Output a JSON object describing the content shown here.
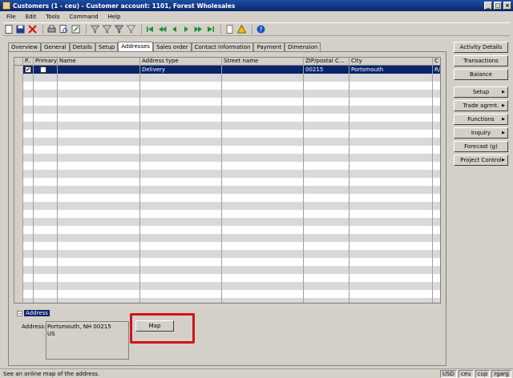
{
  "window": {
    "title": "Customers (1 - ceu) - Customer account: 1101, Forest Wholesales",
    "min_glyph": "_",
    "max_glyph": "□",
    "close_glyph": "×"
  },
  "menu": {
    "items": [
      "File",
      "Edit",
      "Tools",
      "Command",
      "Help"
    ]
  },
  "tabs": [
    "Overview",
    "General",
    "Details",
    "Setup",
    "Addresses",
    "Sales order",
    "Contact information",
    "Payment",
    "Dimension"
  ],
  "grid": {
    "columns": [
      "P..",
      "Primary",
      "Name",
      "Address type",
      "Street name",
      "ZIP/postal C...",
      "City",
      "C"
    ],
    "rows": [
      {
        "primary_marker": "✔",
        "primary": "",
        "name": "",
        "address_type": "Delivery",
        "street": "",
        "zip": "00215",
        "city": "Portsmouth",
        "c": "R/"
      }
    ]
  },
  "address_group": {
    "toggle": "−",
    "header": "Address",
    "label": "Address:",
    "lines": [
      "Portsmouth, NH 00215",
      "US"
    ],
    "map_button": "Map"
  },
  "side_buttons": [
    {
      "label": "Activity Details",
      "submenu": false
    },
    {
      "label": "Transactions",
      "submenu": false
    },
    {
      "label": "Balance",
      "submenu": false
    },
    {
      "label": "Setup",
      "submenu": true
    },
    {
      "label": "Trade agrmt.",
      "submenu": true
    },
    {
      "label": "Functions",
      "submenu": true
    },
    {
      "label": "Inquiry",
      "submenu": true
    },
    {
      "label": "Forecast (g)",
      "submenu": false
    },
    {
      "label": "Project Control",
      "submenu": true
    }
  ],
  "status": {
    "message": "See an online map of the address.",
    "panels": [
      "USD",
      "ceu",
      "cup",
      "rgarg"
    ]
  },
  "colors": {
    "title_bar": "#0a246a",
    "selection": "#0a246a",
    "highlight": "#d0141c"
  }
}
